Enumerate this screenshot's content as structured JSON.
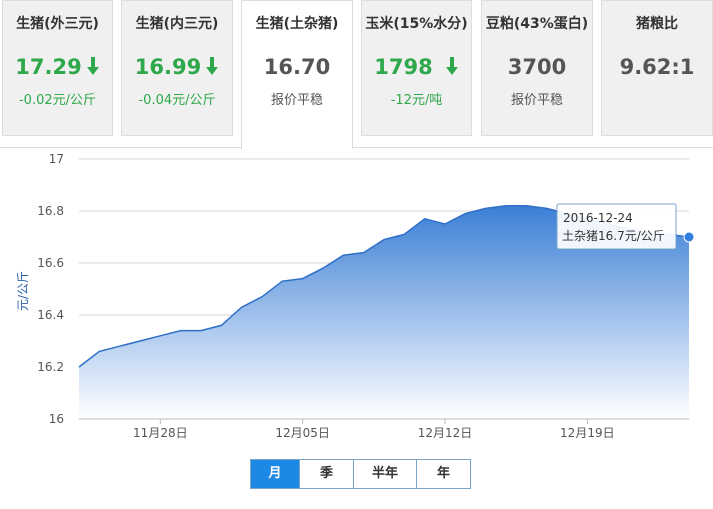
{
  "tabs": [
    {
      "title": "生猪(外三元)",
      "value": "17.29",
      "trend": "down",
      "change": "-0.02元/公斤"
    },
    {
      "title": "生猪(内三元)",
      "value": "16.99",
      "trend": "down",
      "change": "-0.04元/公斤"
    },
    {
      "title": "生猪(土杂猪)",
      "value": "16.70",
      "trend": "flat",
      "change": "报价平稳"
    },
    {
      "title": "玉米(15%水分)",
      "value": "1798",
      "trend": "down",
      "change": "-12元/吨"
    },
    {
      "title": "豆粕(43%蛋白)",
      "value": "3700",
      "trend": "flat",
      "change": "报价平稳"
    },
    {
      "title": "猪粮比",
      "value": "9.62:1",
      "trend": "flat",
      "change": ""
    }
  ],
  "active_tab": 2,
  "colors": {
    "down": "#2ea84a",
    "accent": "#1e88e5",
    "fill_top": "#3b7fd6",
    "fill_bottom": "#ffffff"
  },
  "chart_data": {
    "type": "area",
    "ylabel": "元/公斤",
    "ylim": [
      16,
      17
    ],
    "yticks": [
      "16",
      "16.2",
      "16.4",
      "16.6",
      "16.8",
      "17"
    ],
    "xticks": [
      "11月28日",
      "12月05日",
      "12月12日",
      "12月19日"
    ],
    "xtick_days": [
      4,
      11,
      18,
      25
    ],
    "series": [
      {
        "name": "土杂猪",
        "x": [
          "2016-11-24",
          "2016-11-25",
          "2016-11-26",
          "2016-11-27",
          "2016-11-28",
          "2016-11-29",
          "2016-11-30",
          "2016-12-01",
          "2016-12-02",
          "2016-12-03",
          "2016-12-04",
          "2016-12-05",
          "2016-12-06",
          "2016-12-07",
          "2016-12-08",
          "2016-12-09",
          "2016-12-10",
          "2016-12-11",
          "2016-12-12",
          "2016-12-13",
          "2016-12-14",
          "2016-12-15",
          "2016-12-16",
          "2016-12-17",
          "2016-12-18",
          "2016-12-19",
          "2016-12-20",
          "2016-12-21",
          "2016-12-22",
          "2016-12-23",
          "2016-12-24"
        ],
        "values": [
          16.2,
          16.26,
          16.28,
          16.3,
          16.32,
          16.34,
          16.34,
          16.36,
          16.43,
          16.47,
          16.53,
          16.54,
          16.58,
          16.63,
          16.64,
          16.69,
          16.71,
          16.77,
          16.75,
          16.79,
          16.81,
          16.82,
          16.82,
          16.81,
          16.79,
          16.77,
          16.75,
          16.73,
          16.72,
          16.71,
          16.7
        ]
      }
    ],
    "tooltip": {
      "date": "2016-12-24",
      "text": "土杂猪16.7元/公斤"
    }
  },
  "range_buttons": [
    "月",
    "季",
    "半年",
    "年"
  ],
  "active_range": 0
}
